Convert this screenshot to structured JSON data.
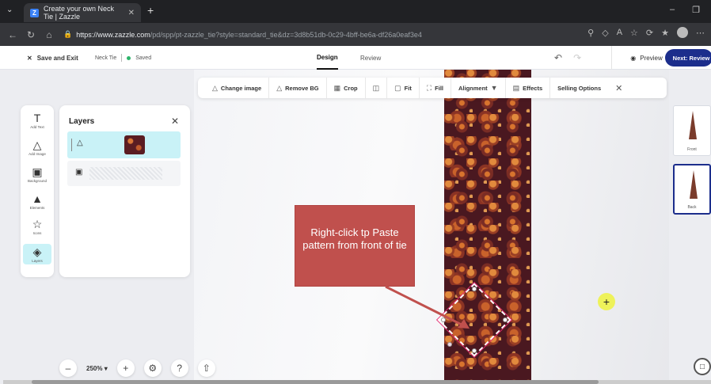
{
  "browser": {
    "tab_title": "Create your own Neck Tie | Zazzle",
    "tab_favicon": "Z",
    "url_host": "https://www.zazzle.com",
    "url_path": "/pd/spp/pt-zazzle_tie?style=standard_tie&dz=3d8b51db-0c29-4bff-be6a-df26a0eaf3e4"
  },
  "appbar": {
    "save_exit": "Save and Exit",
    "product": "Neck Tie",
    "status": "Saved",
    "tab_design": "Design",
    "tab_review": "Review",
    "preview": "Preview",
    "next": "Next: Review"
  },
  "toolbar": {
    "change_image": "Change image",
    "remove_bg": "Remove BG",
    "crop": "Crop",
    "fit": "Fit",
    "fill": "Fill",
    "alignment": "Alignment",
    "effects": "Effects",
    "selling_options": "Selling Options"
  },
  "rail": {
    "items": [
      {
        "label": "Add Text"
      },
      {
        "label": "Add Image"
      },
      {
        "label": "Background"
      },
      {
        "label": "Elements"
      },
      {
        "label": "Icons"
      },
      {
        "label": "Layers"
      }
    ]
  },
  "layers_panel": {
    "title": "Layers"
  },
  "views": [
    {
      "label": "Front"
    },
    {
      "label": "Back"
    }
  ],
  "callout": {
    "text": "Right-click tp Paste pattern from front of tie"
  },
  "zoom": {
    "value": "250%"
  },
  "colors": {
    "accent": "#1c2e8c",
    "active_bg": "#c9f2f7",
    "callout": "#c0504d",
    "saved_dot": "#2db46b"
  }
}
